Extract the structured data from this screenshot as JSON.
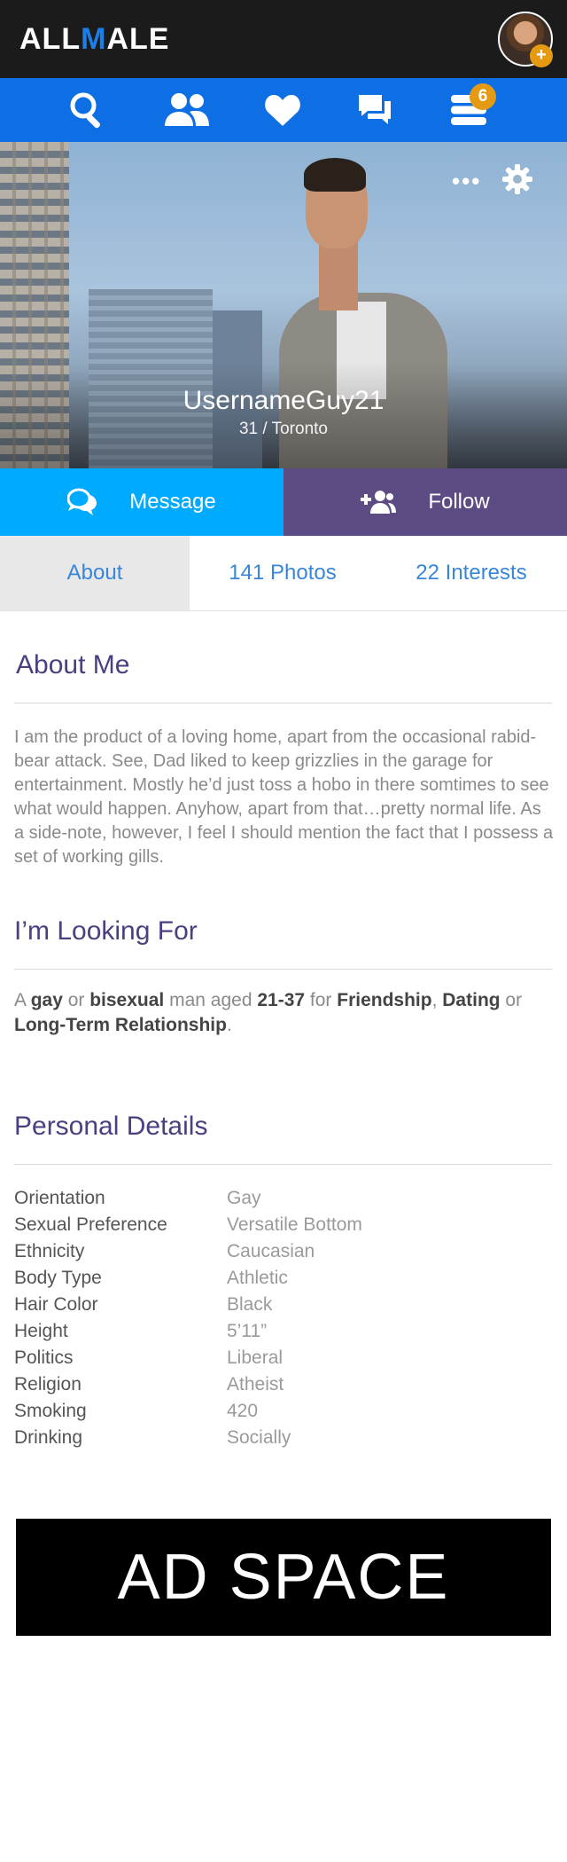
{
  "header": {
    "logo_part1": "ALL",
    "logo_part2": "M",
    "logo_part3": "ALE",
    "avatar_badge": "+"
  },
  "nav": {
    "items": [
      "search-icon",
      "users-icon",
      "heart-icon",
      "chat-icon",
      "menu-icon"
    ],
    "menu_badge": "6"
  },
  "profile": {
    "username": "UsernameGuy21",
    "meta": "31 / Toronto"
  },
  "actions": {
    "message_label": "Message",
    "follow_label": "Follow"
  },
  "tabs": [
    {
      "label": "About",
      "active": true
    },
    {
      "label": "141 Photos",
      "active": false
    },
    {
      "label": "22 Interests",
      "active": false
    }
  ],
  "about": {
    "title": "About Me",
    "text": "I am the product of a loving home, apart from the occasional rabid-bear attack. See, Dad liked to keep grizzlies in the garage for entertainment. Mostly he’d just toss a hobo in there somtimes to see what would happen. Anyhow, apart from that…pretty normal life. As a side-note, however, I feel I should mention the fact that I possess a set of working gills."
  },
  "looking": {
    "title": "I’m Looking For",
    "text_a": "A ",
    "orient1": "gay",
    "text_b": " or ",
    "orient2": "bisexual",
    "text_c": " man aged ",
    "age_range": "21-37",
    "text_d": " for ",
    "goal1": "Friendship",
    "text_e": ", ",
    "goal2": "Dating",
    "text_f": " or ",
    "goal3": "Long-Term Relationship",
    "text_g": "."
  },
  "details": {
    "title": "Personal Details",
    "rows": [
      {
        "label": "Orientation",
        "value": "Gay"
      },
      {
        "label": "Sexual Preference",
        "value": "Versatile Bottom"
      },
      {
        "label": "Ethnicity",
        "value": "Caucasian"
      },
      {
        "label": "Body Type",
        "value": "Athletic"
      },
      {
        "label": "Hair Color",
        "value": "Black"
      },
      {
        "label": "Height",
        "value": "5’11”"
      },
      {
        "label": "Politics",
        "value": "Liberal"
      },
      {
        "label": "Religion",
        "value": "Atheist"
      },
      {
        "label": "Smoking",
        "value": "420"
      },
      {
        "label": "Drinking",
        "value": "Socially"
      }
    ]
  },
  "ad": {
    "label": "AD SPACE"
  },
  "colors": {
    "topbar": "#1b1b1b",
    "nav": "#0d6fe3",
    "badge": "#e59a14",
    "message": "#00aaff",
    "follow": "#5d4b83",
    "section_title": "#4a3f80",
    "tab_text": "#3a86d6"
  }
}
